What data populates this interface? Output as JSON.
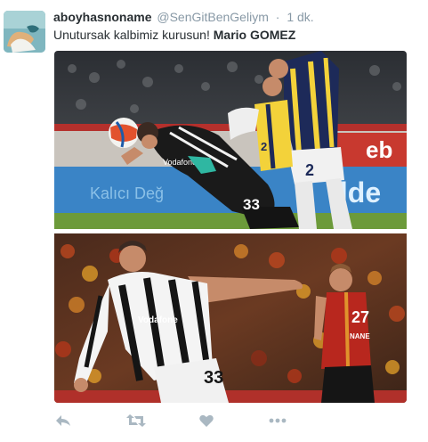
{
  "tweet": {
    "display_name": "aboyhasnoname",
    "handle": "@SenGitBenGeliym",
    "separator": "·",
    "timestamp": "1 dk.",
    "text_normal": "Unutursak kalbimiz kurusun! ",
    "text_bold": "Mario GOMEZ"
  },
  "photo1": {
    "board_text_1": "Kalıcı Değ",
    "board_text_2": "ilde",
    "board_text_3": "eb",
    "sponsor": "Vodafone",
    "player1_number": "33",
    "player2_number": "2",
    "player3_number": "2"
  },
  "photo2": {
    "sponsor": "Vodafone",
    "player1_number": "33",
    "player2_number": "27",
    "player2_name": "NANE"
  },
  "actions": {
    "reply_icon": "reply-icon",
    "retweet_icon": "retweet-icon",
    "like_icon": "heart-icon",
    "more_icon": "more-dots-icon",
    "icon_color": "#aab8c2"
  }
}
